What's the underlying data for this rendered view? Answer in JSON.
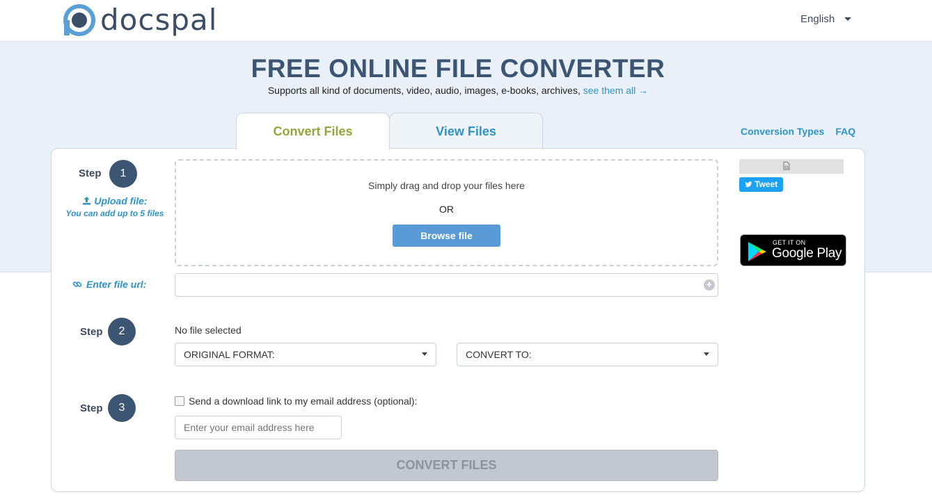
{
  "header": {
    "logo_text": "docspal",
    "language": "English"
  },
  "hero": {
    "title": "FREE ONLINE FILE CONVERTER",
    "subtitle": "Supports all kind of documents, video, audio, images, e-books, archives,",
    "see_all_link": "see them all →"
  },
  "tabs": [
    {
      "label": "Convert Files",
      "active": true
    },
    {
      "label": "View Files",
      "active": false
    }
  ],
  "top_links": {
    "conversion_types": "Conversion Types",
    "faq": "FAQ"
  },
  "step1": {
    "label": "Step",
    "number": "1",
    "upload_label": "Upload file:",
    "upload_hint": "You can add up to 5 files",
    "drop_text": "Simply drag and drop your files here",
    "or_text": "OR",
    "browse_label": "Browse file",
    "url_label": "Enter file url:",
    "url_value": ""
  },
  "step2": {
    "label": "Step",
    "number": "2",
    "no_file_text": "No file selected",
    "original_format_label": "ORIGINAL FORMAT:",
    "convert_to_label": "CONVERT TO:"
  },
  "step3": {
    "label": "Step",
    "number": "3",
    "email_checkbox_label": "Send a download link to my email address (optional):",
    "email_checked": false,
    "email_placeholder": "Enter your email address here",
    "convert_button": "CONVERT FILES"
  },
  "sidebar": {
    "tweet_label": "Tweet",
    "gplay_small": "GET IT ON",
    "gplay_big": "Google Play"
  },
  "colors": {
    "accent_blue": "#2d93c8",
    "title_navy": "#3b5573",
    "tab_green": "#8ea93a",
    "hero_bg": "#e9f0f8",
    "browse_button": "#5b9bd5",
    "disabled_button": "#c3c8ce"
  },
  "icons": [
    "upload-icon",
    "link-icon",
    "plus-icon",
    "caret-down-icon",
    "document-icon",
    "twitter-icon",
    "google-play-icon"
  ]
}
